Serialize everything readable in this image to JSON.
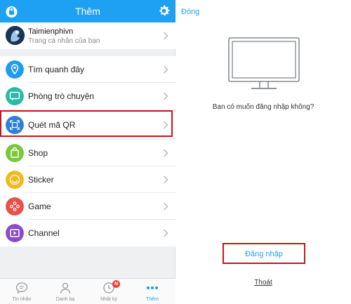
{
  "left": {
    "header": {
      "title": "Thêm",
      "lock_icon": "lock-icon",
      "settings_icon": "gear-icon"
    },
    "profile": {
      "name": "Taimienphivn",
      "subtitle": "Trang cá nhân của bạn"
    },
    "menu": [
      {
        "label": "Tìm quanh đây",
        "icon": "location-pin-icon",
        "color": "#1e9cf0"
      },
      {
        "label": "Phòng trò chuyện",
        "icon": "chat-room-icon",
        "color": "#2cb8a8"
      },
      {
        "label": "Quét mã QR",
        "icon": "qr-scan-icon",
        "color": "#2d7fd8"
      },
      {
        "label": "Shop",
        "icon": "shop-bag-icon",
        "color": "#7cc63a"
      },
      {
        "label": "Sticker",
        "icon": "smiley-icon",
        "color": "#f3b81b"
      },
      {
        "label": "Game",
        "icon": "gamepad-icon",
        "color": "#e8504a"
      },
      {
        "label": "Channel",
        "icon": "video-channel-icon",
        "color": "#8a4bc8"
      }
    ],
    "tabs": [
      {
        "label": "Tin nhắn",
        "icon": "message-icon"
      },
      {
        "label": "Danh bạ",
        "icon": "contacts-icon"
      },
      {
        "label": "Nhật ký",
        "icon": "clock-icon",
        "badge": "N"
      },
      {
        "label": "Thêm",
        "icon": "more-dots-icon",
        "active": true
      }
    ]
  },
  "right": {
    "close": "Đóng",
    "question": "Bạn có muốn đăng nhập không?",
    "login": "Đăng nhập",
    "exit": "Thoát"
  },
  "colors": {
    "accent": "#1ea1f2",
    "highlight": "#c8151b",
    "badge": "#e8413a"
  }
}
